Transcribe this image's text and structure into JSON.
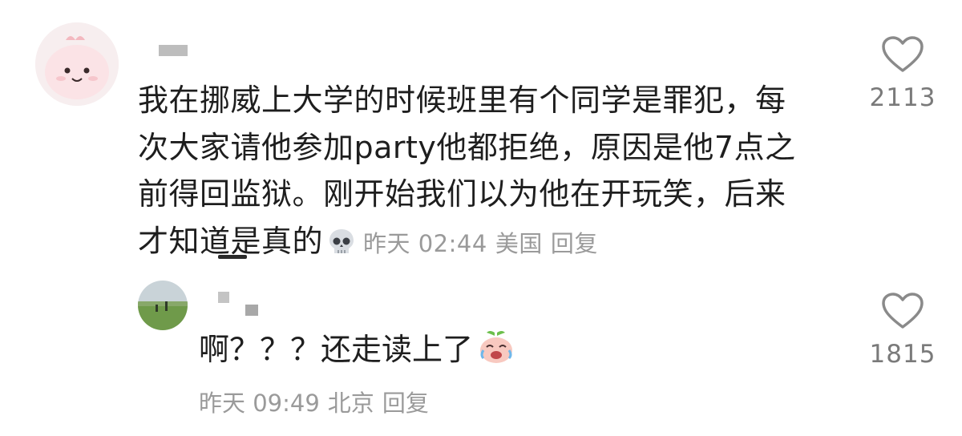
{
  "comments": [
    {
      "text": "我在挪威上大学的时候班里有个同学是罪犯，每次大家请他参加party他都拒绝，原因是他7点之前得回监狱。刚开始我们以为他在开玩笑，后来才知道是真的",
      "emoji": "skull-emoji",
      "time": "昨天 02:44",
      "location": "美国",
      "reply_label": "回复",
      "likes": "2113",
      "avatar": "pink-cartoon-avatar"
    }
  ],
  "replies": [
    {
      "text": "啊？？？还走读上了",
      "emoji": "crying-laughing-peach-emoji",
      "time": "昨天 09:49",
      "location": "北京",
      "reply_label": "回复",
      "likes": "1815",
      "avatar": "grassland-photo-avatar"
    }
  ],
  "colors": {
    "meta_gray": "#9a9a9a",
    "text": "#1e1e1e",
    "like_icon": "#8a8a8a"
  }
}
